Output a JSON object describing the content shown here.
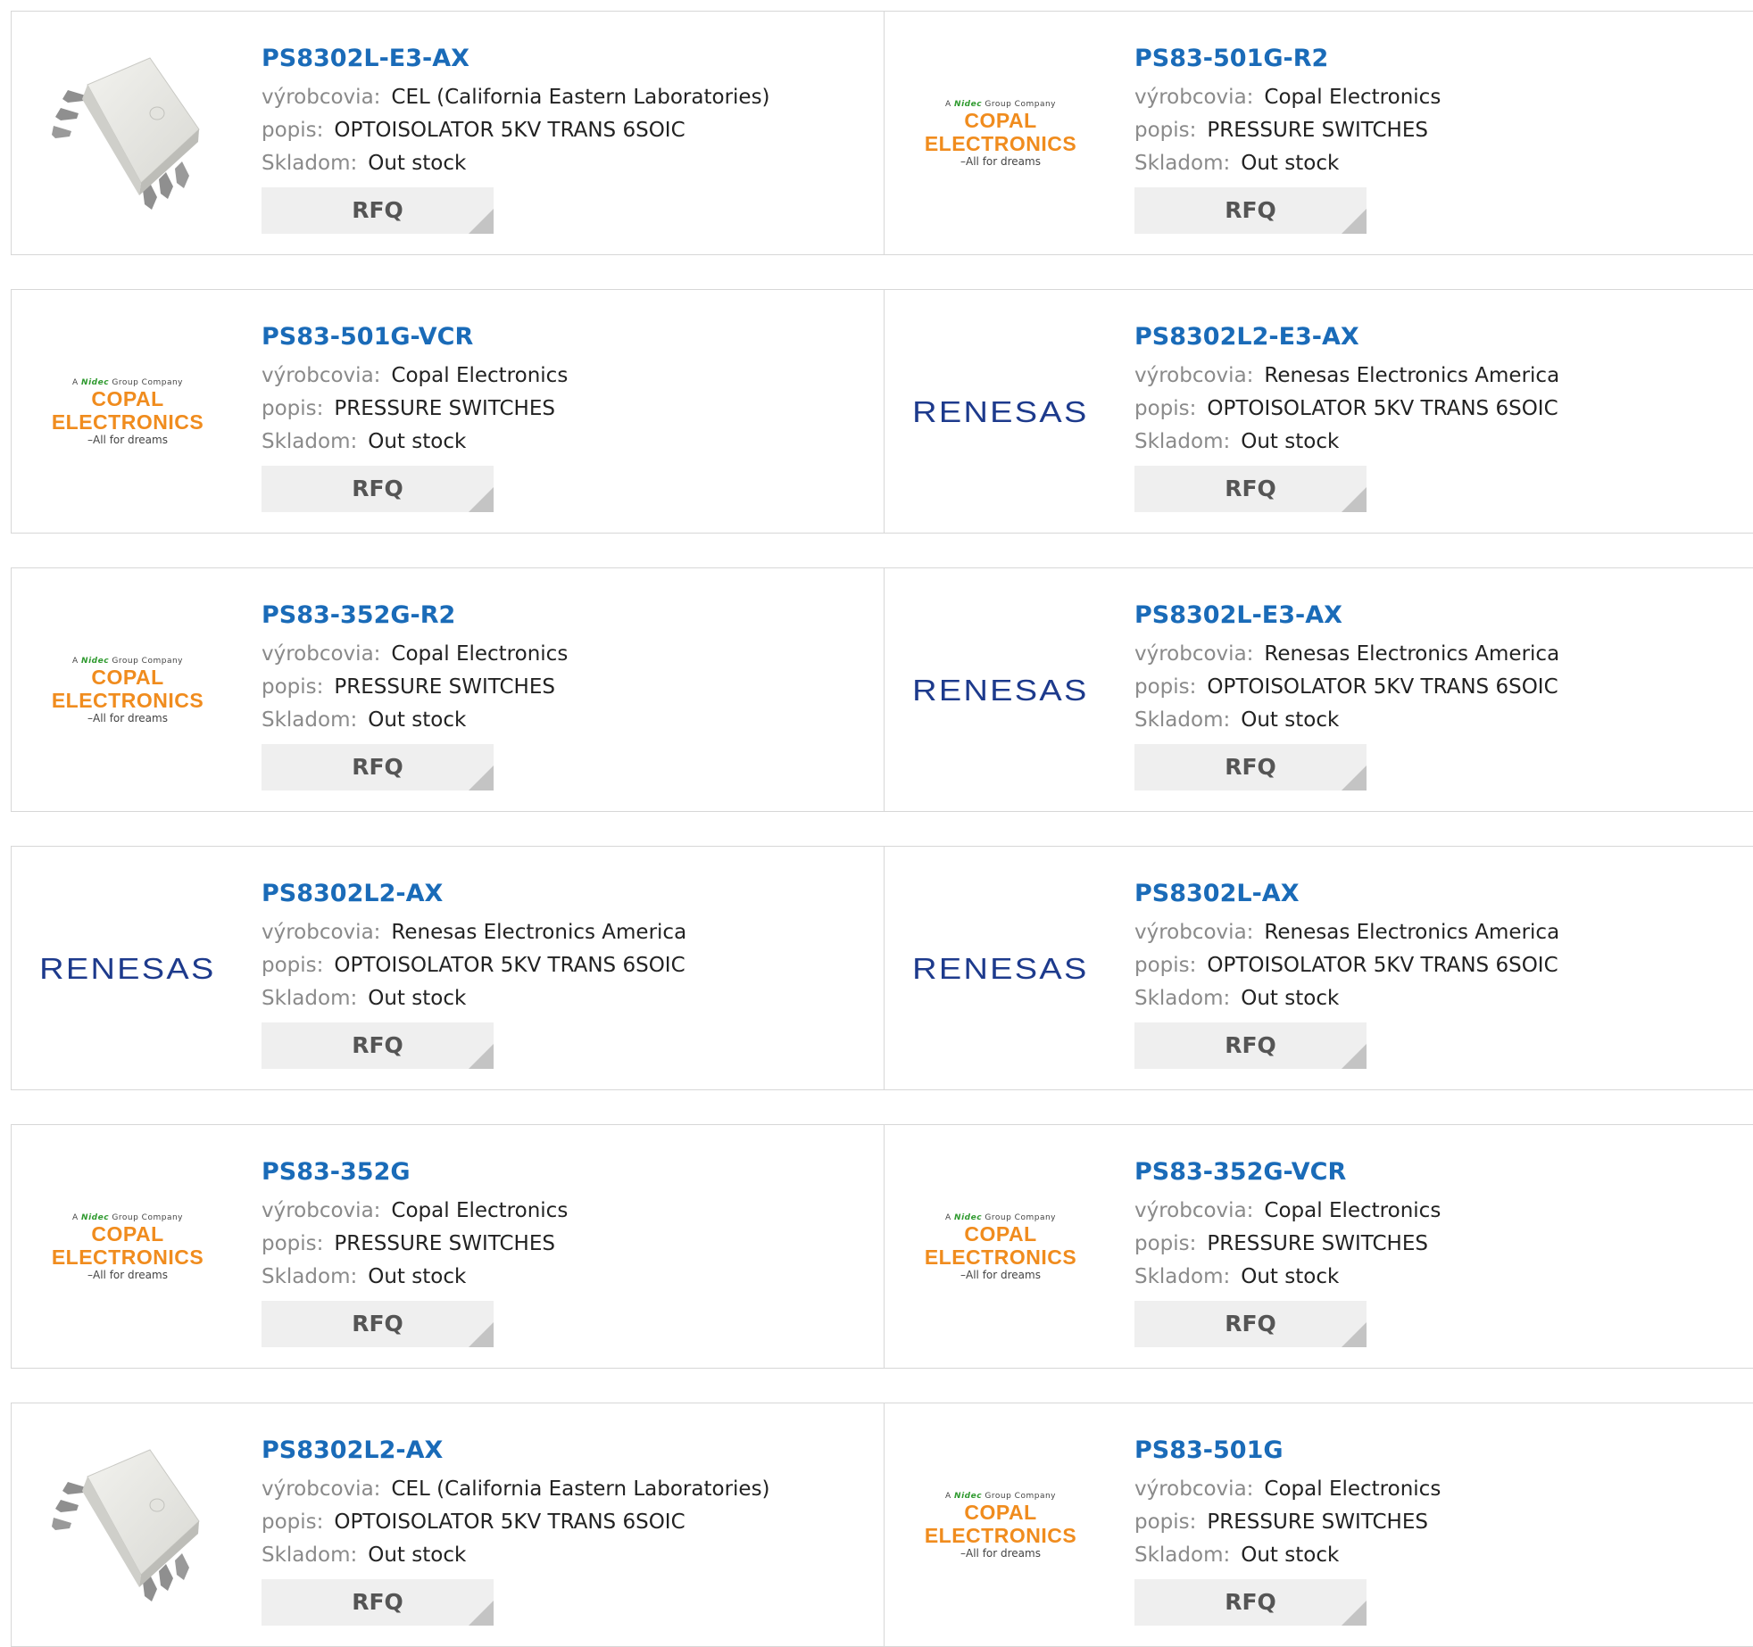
{
  "labels": {
    "manufacturer": "výrobcovia:",
    "description": "popis:",
    "stock": "Skladom:"
  },
  "rfq_label": "RFQ",
  "colors": {
    "part_link": "#1a6bb8",
    "copal_orange": "#f08c1e",
    "renesas_blue": "#1d3a8c",
    "rfq_bg": "#efefef"
  },
  "logos": {
    "copal": {
      "top_prefix": "A",
      "top_brand": "Nidec",
      "top_suffix": "Group Company",
      "main": "COPAL ELECTRONICS",
      "sub": "–All for dreams"
    },
    "renesas": {
      "text": "RENESAS"
    }
  },
  "rows": [
    [
      {
        "part": "PS8302L-E3-AX",
        "manufacturer": "CEL (California Eastern Laboratories)",
        "description": "OPTOISOLATOR 5KV TRANS 6SOIC",
        "stock": "Out stock",
        "image": "chip"
      },
      {
        "part": "PS83-501G-R2",
        "manufacturer": "Copal Electronics",
        "description": "PRESSURE SWITCHES",
        "stock": "Out stock",
        "image": "copal"
      }
    ],
    [
      {
        "part": "PS83-501G-VCR",
        "manufacturer": "Copal Electronics",
        "description": "PRESSURE SWITCHES",
        "stock": "Out stock",
        "image": "copal"
      },
      {
        "part": "PS8302L2-E3-AX",
        "manufacturer": "Renesas Electronics America",
        "description": "OPTOISOLATOR 5KV TRANS 6SOIC",
        "stock": "Out stock",
        "image": "renesas"
      }
    ],
    [
      {
        "part": "PS83-352G-R2",
        "manufacturer": "Copal Electronics",
        "description": "PRESSURE SWITCHES",
        "stock": "Out stock",
        "image": "copal"
      },
      {
        "part": "PS8302L-E3-AX",
        "manufacturer": "Renesas Electronics America",
        "description": "OPTOISOLATOR 5KV TRANS 6SOIC",
        "stock": "Out stock",
        "image": "renesas"
      }
    ],
    [
      {
        "part": "PS8302L2-AX",
        "manufacturer": "Renesas Electronics America",
        "description": "OPTOISOLATOR 5KV TRANS 6SOIC",
        "stock": "Out stock",
        "image": "renesas"
      },
      {
        "part": "PS8302L-AX",
        "manufacturer": "Renesas Electronics America",
        "description": "OPTOISOLATOR 5KV TRANS 6SOIC",
        "stock": "Out stock",
        "image": "renesas"
      }
    ],
    [
      {
        "part": "PS83-352G",
        "manufacturer": "Copal Electronics",
        "description": "PRESSURE SWITCHES",
        "stock": "Out stock",
        "image": "copal"
      },
      {
        "part": "PS83-352G-VCR",
        "manufacturer": "Copal Electronics",
        "description": "PRESSURE SWITCHES",
        "stock": "Out stock",
        "image": "copal"
      }
    ],
    [
      {
        "part": "PS8302L2-AX",
        "manufacturer": "CEL (California Eastern Laboratories)",
        "description": "OPTOISOLATOR 5KV TRANS 6SOIC",
        "stock": "Out stock",
        "image": "chip"
      },
      {
        "part": "PS83-501G",
        "manufacturer": "Copal Electronics",
        "description": "PRESSURE SWITCHES",
        "stock": "Out stock",
        "image": "copal"
      }
    ]
  ]
}
